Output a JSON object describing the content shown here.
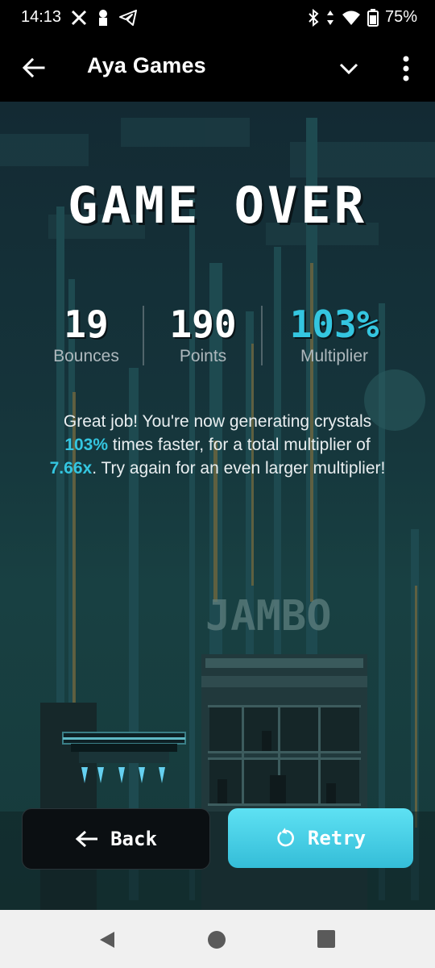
{
  "status_bar": {
    "time": "14:13",
    "battery": "75%",
    "left_icons": [
      "x-logo-icon",
      "person-icon",
      "telegram-icon"
    ],
    "right_icons": [
      "bluetooth-icon",
      "data-arrows-icon",
      "wifi-icon",
      "battery-icon"
    ]
  },
  "app_bar": {
    "title": "Aya Games",
    "back_icon": "arrow-left-icon",
    "expand_icon": "chevron-down-icon",
    "menu_icon": "more-vert-icon"
  },
  "game": {
    "title": "GAME OVER",
    "stats": [
      {
        "value": "19",
        "label": "Bounces"
      },
      {
        "value": "190",
        "label": "Points"
      },
      {
        "value": "103%",
        "label": "Multiplier"
      }
    ],
    "message": {
      "part1": "Great job! You're now generating crystals",
      "highlight1": "103%",
      "part2": " times faster, for a total multiplier of",
      "highlight2": "7.66x",
      "part3": ". Try again for an even larger multiplier!"
    },
    "buttons": {
      "back": "Back",
      "retry": "Retry"
    },
    "background_sign": "JAMBO"
  },
  "colors": {
    "accent": "#34c6e0",
    "retry_button": "#4fd6ee",
    "back_button": "#0b0f12"
  }
}
